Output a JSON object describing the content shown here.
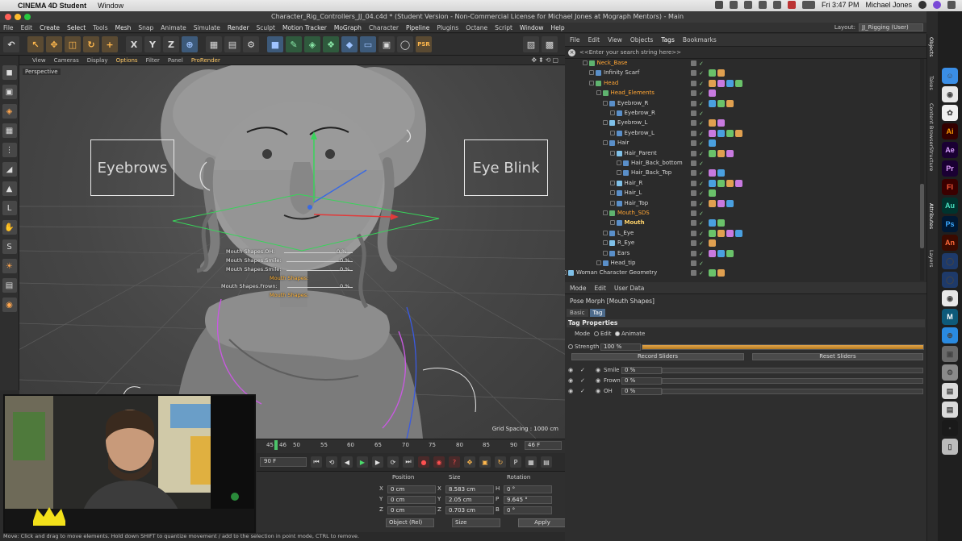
{
  "macbar": {
    "app": "CINEMA 4D Student",
    "window_menu": "Window",
    "document_title": "Character_Rig_Controllers_JJ_04.c4d * (Student Version - Non-Commercial License for Michael Jones at Mograph Mentors) - Main",
    "clock": "Fri 3:47 PM",
    "user": "Michael Jones"
  },
  "menu": [
    "File",
    "Edit",
    "Create",
    "Select",
    "Tools",
    "Mesh",
    "Snap",
    "Animate",
    "Simulate",
    "Render",
    "Sculpt",
    "Motion Tracker",
    "MoGraph",
    "Character",
    "Pipeline",
    "Plugins",
    "Octane",
    "Script",
    "Window",
    "Help"
  ],
  "layout": {
    "label": "Layout:",
    "value": "JJ_Rigging (User)"
  },
  "viewport": {
    "menu": [
      "View",
      "Cameras",
      "Display",
      "Options",
      "Filter",
      "Panel",
      "ProRender"
    ],
    "label": "Perspective",
    "grid_spacing": "Grid Spacing : 1000 cm",
    "eyebrows_box": "Eyebrows",
    "eyeblink_box": "Eye Blink",
    "hud": [
      {
        "label": "Mouth Shapes.OH:",
        "value": "0 %"
      },
      {
        "label": "Mouth Shapes.Smile:",
        "value": "0 %"
      },
      {
        "label": "Mouth Shapes.Smile:",
        "value": "0 %"
      },
      {
        "label": "Mouth Shapes:",
        "value": ""
      },
      {
        "label": "Mouth Shapes.Frown:",
        "value": "0 %"
      },
      {
        "label": "Mouth Shapes:",
        "value": ""
      }
    ]
  },
  "timeline": {
    "ticks": [
      "45",
      "46",
      "50",
      "55",
      "60",
      "65",
      "70",
      "75",
      "80",
      "85",
      "90"
    ],
    "frame_end": "46 F",
    "frame_field": "90 F"
  },
  "coords": {
    "position_header": "Position",
    "size_header": "Size",
    "rotation_header": "Rotation",
    "rows": [
      {
        "axis": "X",
        "pos": "0 cm",
        "size_axis": "X",
        "size": "8.583 cm",
        "rot_axis": "H",
        "rot": "0 °"
      },
      {
        "axis": "Y",
        "pos": "0 cm",
        "size_axis": "Y",
        "size": "2.05 cm",
        "rot_axis": "P",
        "rot": "9.645 °"
      },
      {
        "axis": "Z",
        "pos": "0 cm",
        "size_axis": "Z",
        "size": "0.703 cm",
        "rot_axis": "B",
        "rot": "0 °"
      }
    ],
    "object_mode": "Object (Rel)",
    "size_mode": "Size",
    "apply": "Apply"
  },
  "status": "Move: Click and drag to move elements. Hold down SHIFT to quantize movement / add to the selection in point mode, CTRL to remove.",
  "object_manager": {
    "menu": [
      "File",
      "Edit",
      "View",
      "Objects",
      "Tags",
      "Bookmarks"
    ],
    "search_placeholder": "<<Enter your search string here>>",
    "rows": [
      {
        "name": "Neck_Base",
        "depth": 3,
        "color": "o"
      },
      {
        "name": "Infinity Scarf",
        "depth": 4,
        "color": ""
      },
      {
        "name": "Head",
        "depth": 4,
        "color": "o"
      },
      {
        "name": "Head_Elements",
        "depth": 5,
        "color": "o"
      },
      {
        "name": "Eyebrow_R",
        "depth": 6,
        "color": ""
      },
      {
        "name": "Eyebrow_R",
        "depth": 7,
        "color": ""
      },
      {
        "name": "Eyebrow_L",
        "depth": 6,
        "color": ""
      },
      {
        "name": "Eyebrow_L",
        "depth": 7,
        "color": ""
      },
      {
        "name": "Hair",
        "depth": 6,
        "color": ""
      },
      {
        "name": "Hair_Parent",
        "depth": 7,
        "color": ""
      },
      {
        "name": "Hair_Back_bottom",
        "depth": 8,
        "color": ""
      },
      {
        "name": "Hair_Back_Top",
        "depth": 8,
        "color": ""
      },
      {
        "name": "Hair_R",
        "depth": 7,
        "color": ""
      },
      {
        "name": "Hair_L",
        "depth": 7,
        "color": ""
      },
      {
        "name": "Hair_Top",
        "depth": 7,
        "color": ""
      },
      {
        "name": "Mouth_SDS",
        "depth": 6,
        "color": "o"
      },
      {
        "name": "Mouth",
        "depth": 7,
        "color": "y"
      },
      {
        "name": "L_Eye",
        "depth": 6,
        "color": ""
      },
      {
        "name": "R_Eye",
        "depth": 6,
        "color": ""
      },
      {
        "name": "Ears",
        "depth": 6,
        "color": ""
      },
      {
        "name": "Head_tip",
        "depth": 5,
        "color": ""
      },
      {
        "name": "Woman Character Geometry",
        "depth": 0,
        "color": ""
      }
    ]
  },
  "attribute_manager": {
    "menu": [
      "Mode",
      "Edit",
      "User Data"
    ],
    "title": "Pose Morph [Mouth Shapes]",
    "tabs": [
      "Basic",
      "Tag"
    ],
    "section": "Tag Properties",
    "mode_label": "Mode",
    "mode_edit": "Edit",
    "mode_animate": "Animate",
    "strength_label": "Strength",
    "strength_value": "100 %",
    "strength_fraction": 1.0,
    "record_sliders": "Record Sliders",
    "reset_sliders": "Reset Sliders",
    "morphs": [
      {
        "name": "Smile",
        "value": "0 %"
      },
      {
        "name": "Frown",
        "value": "0 %"
      },
      {
        "name": "OH",
        "value": "0 %"
      }
    ]
  },
  "right_tabs": [
    "Objects",
    "Takes",
    "Content Browser",
    "Structure",
    "Attributes",
    "Layers"
  ],
  "dock_apps": [
    "Finder-icon",
    "Chrome-icon",
    "Photos-icon",
    "Illustrator-icon",
    "After-Effects-icon",
    "Premiere-icon",
    "Flash-icon",
    "Audition-icon",
    "Photoshop-icon",
    "Animate-icon",
    "Cinema4D-icon",
    "Cinema4D-icon",
    "Chrome-icon",
    "Mograph-icon",
    "Safari-icon",
    "Preview-icon",
    "System-Preferences-icon",
    "Document-icon",
    "Document-icon",
    "Terminal-icon",
    "Trash-icon"
  ]
}
